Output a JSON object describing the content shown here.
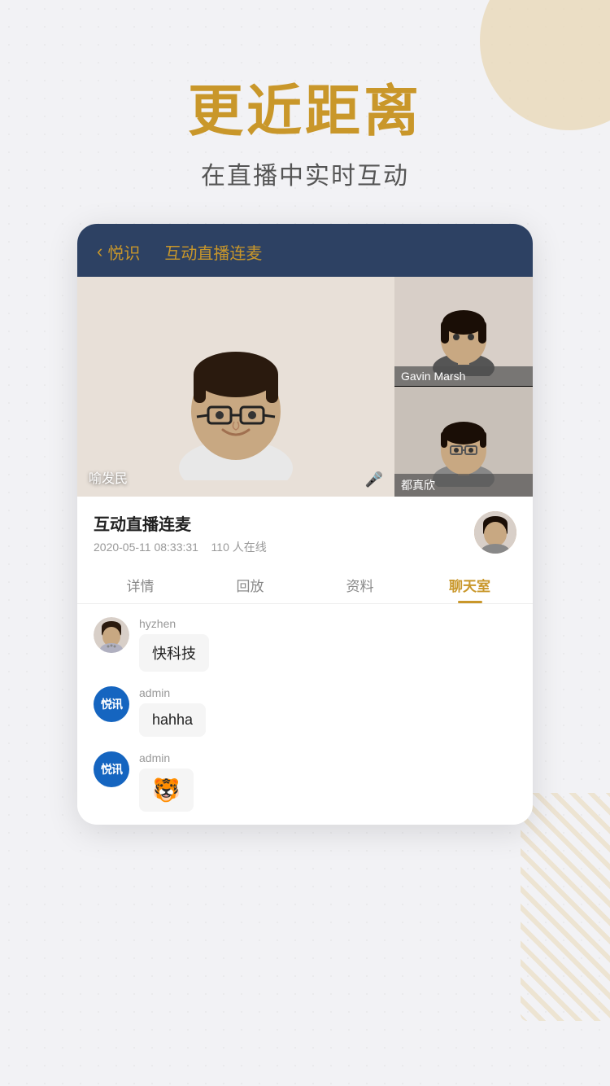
{
  "background": {
    "bg_color": "#f2f2f5"
  },
  "hero": {
    "title": "更近距离",
    "subtitle": "在直播中实时互动"
  },
  "card": {
    "header": {
      "back_text": "悦识",
      "title": "互动直播连麦"
    },
    "video": {
      "main_person_name": "喻发民",
      "side_top_name": "Gavin Marsh",
      "side_bottom_name": "都真欣"
    },
    "info": {
      "title": "互动直播连麦",
      "date": "2020-05-11 08:33:31",
      "online_count": "110 人在线"
    },
    "tabs": [
      {
        "label": "详情",
        "active": false
      },
      {
        "label": "回放",
        "active": false
      },
      {
        "label": "资料",
        "active": false
      },
      {
        "label": "聊天室",
        "active": true
      }
    ],
    "chat": {
      "messages": [
        {
          "username": "hyzhen",
          "avatar_type": "photo",
          "text": "快科技",
          "is_emoji": false
        },
        {
          "username": "admin",
          "avatar_type": "brand",
          "brand_text": "悦讯",
          "text": "hahha",
          "is_emoji": false
        },
        {
          "username": "admin",
          "avatar_type": "brand",
          "brand_text": "悦讯",
          "text": "🐯",
          "is_emoji": true
        }
      ]
    }
  }
}
